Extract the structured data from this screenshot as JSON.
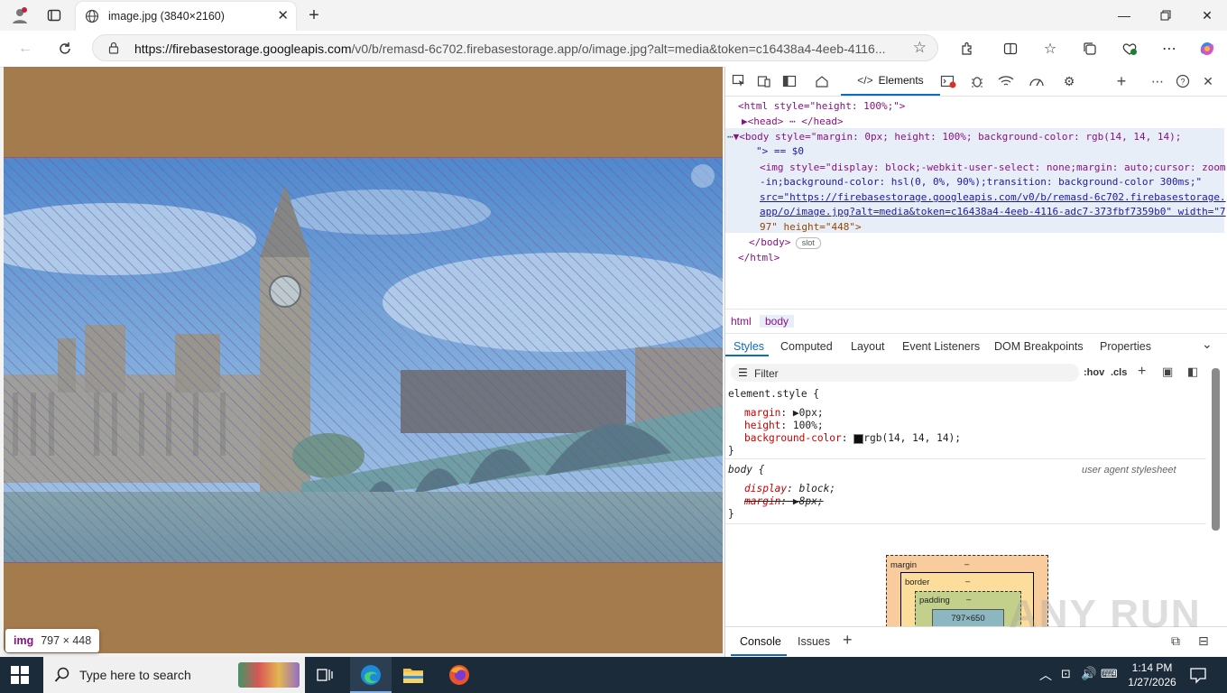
{
  "browser": {
    "tab_title": "image.jpg (3840×2160)",
    "url_host": "https://firebasestorage.googleapis.com",
    "url_path": "/v0/b/remasd-6c702.firebasestorage.app/o/image.jpg?alt=media&token=c16438a4-4eeb-4116..."
  },
  "page": {
    "background_color": "#a47b4d",
    "image_tooltip_tag": "img",
    "image_tooltip_size": "797 × 448"
  },
  "devtools": {
    "active_tab": "Elements",
    "dom_lines": [
      {
        "t": "<html style=\"height: 100%;\">"
      },
      {
        "t": "▶<head> ⋯ </head>"
      },
      {
        "t": "▼<body style=\"margin: 0px; height: 100%; background-color: rgb(14, 14, 14);"
      },
      {
        "t": "\"> == $0"
      },
      {
        "t": "<img style=\"display: block;-webkit-user-select: none;margin: auto;cursor: zoom"
      },
      {
        "t": "-in;background-color: hsl(0, 0%, 90%);transition: background-color 300ms;\""
      },
      {
        "t": "src=\"https://firebasestorage.googleapis.com/v0/b/remasd-6c702.firebasestorage."
      },
      {
        "t": "app/o/image.jpg?alt=media&token=c16438a4-4eeb-4116-adc7-373fbf7359b0\" width=\"7"
      },
      {
        "t": "97\" height=\"448\">"
      },
      {
        "t": "</body>"
      },
      {
        "t": "</html>"
      }
    ],
    "slot_badge": "slot",
    "breadcrumbs": [
      "html",
      "body"
    ],
    "panel_tabs": [
      "Styles",
      "Computed",
      "Layout",
      "Event Listeners",
      "DOM Breakpoints",
      "Properties"
    ],
    "filter_placeholder": "Filter",
    "filter_buttons": [
      ":hov",
      ".cls"
    ],
    "styles": {
      "rule1_selector": "element.style {",
      "rule1_props": [
        {
          "name": "margin",
          "value": "0px;"
        },
        {
          "name": "height",
          "value": "100%;"
        },
        {
          "name": "background-color",
          "value": "rgb(14, 14, 14);"
        }
      ],
      "close": "}",
      "rule2_selector": "body {",
      "rule2_source": "user agent stylesheet",
      "rule2_props": [
        {
          "name": "display",
          "value": "block;"
        },
        {
          "name": "margin",
          "value": "8px;"
        }
      ]
    },
    "box_model": {
      "margin": "margin",
      "border": "border",
      "padding": "padding",
      "dash": "–",
      "content": "797×650"
    },
    "bottom_tabs": [
      "Console",
      "Issues"
    ]
  },
  "taskbar": {
    "search_placeholder": "Type here to search",
    "time": "1:14 PM",
    "date": "1/27/2026"
  },
  "watermark": "ANY RUN"
}
